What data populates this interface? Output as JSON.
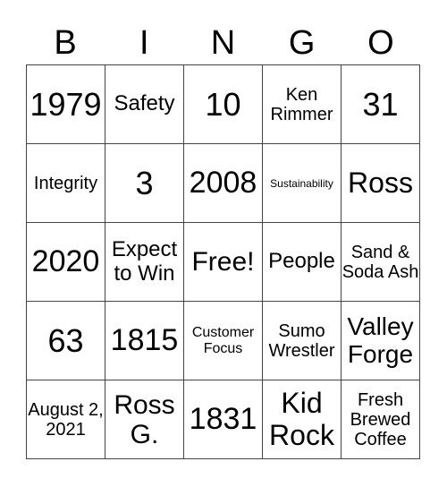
{
  "header": [
    "B",
    "I",
    "N",
    "G",
    "O"
  ],
  "cells": [
    [
      {
        "t": "1979",
        "s": 36
      },
      {
        "t": "Safety",
        "s": 24
      },
      {
        "t": "10",
        "s": 36
      },
      {
        "t": "Ken Rimmer",
        "s": 20
      },
      {
        "t": "31",
        "s": 36
      }
    ],
    [
      {
        "t": "Integrity",
        "s": 20
      },
      {
        "t": "3",
        "s": 36
      },
      {
        "t": "2008",
        "s": 34
      },
      {
        "t": "Sustainability",
        "s": 12
      },
      {
        "t": "Ross",
        "s": 32
      }
    ],
    [
      {
        "t": "2020",
        "s": 34
      },
      {
        "t": "Expect to Win",
        "s": 24
      },
      {
        "t": "Free!",
        "s": 30
      },
      {
        "t": "People",
        "s": 24
      },
      {
        "t": "Sand & Soda Ash",
        "s": 20
      }
    ],
    [
      {
        "t": "63",
        "s": 36
      },
      {
        "t": "1815",
        "s": 34
      },
      {
        "t": "Customer Focus",
        "s": 16
      },
      {
        "t": "Sumo Wrestler",
        "s": 20
      },
      {
        "t": "Valley Forge",
        "s": 28
      }
    ],
    [
      {
        "t": "August 2, 2021",
        "s": 20
      },
      {
        "t": "Ross G.",
        "s": 30
      },
      {
        "t": "1831",
        "s": 34
      },
      {
        "t": "Kid Rock",
        "s": 32
      },
      {
        "t": "Fresh Brewed Coffee",
        "s": 20
      }
    ]
  ]
}
